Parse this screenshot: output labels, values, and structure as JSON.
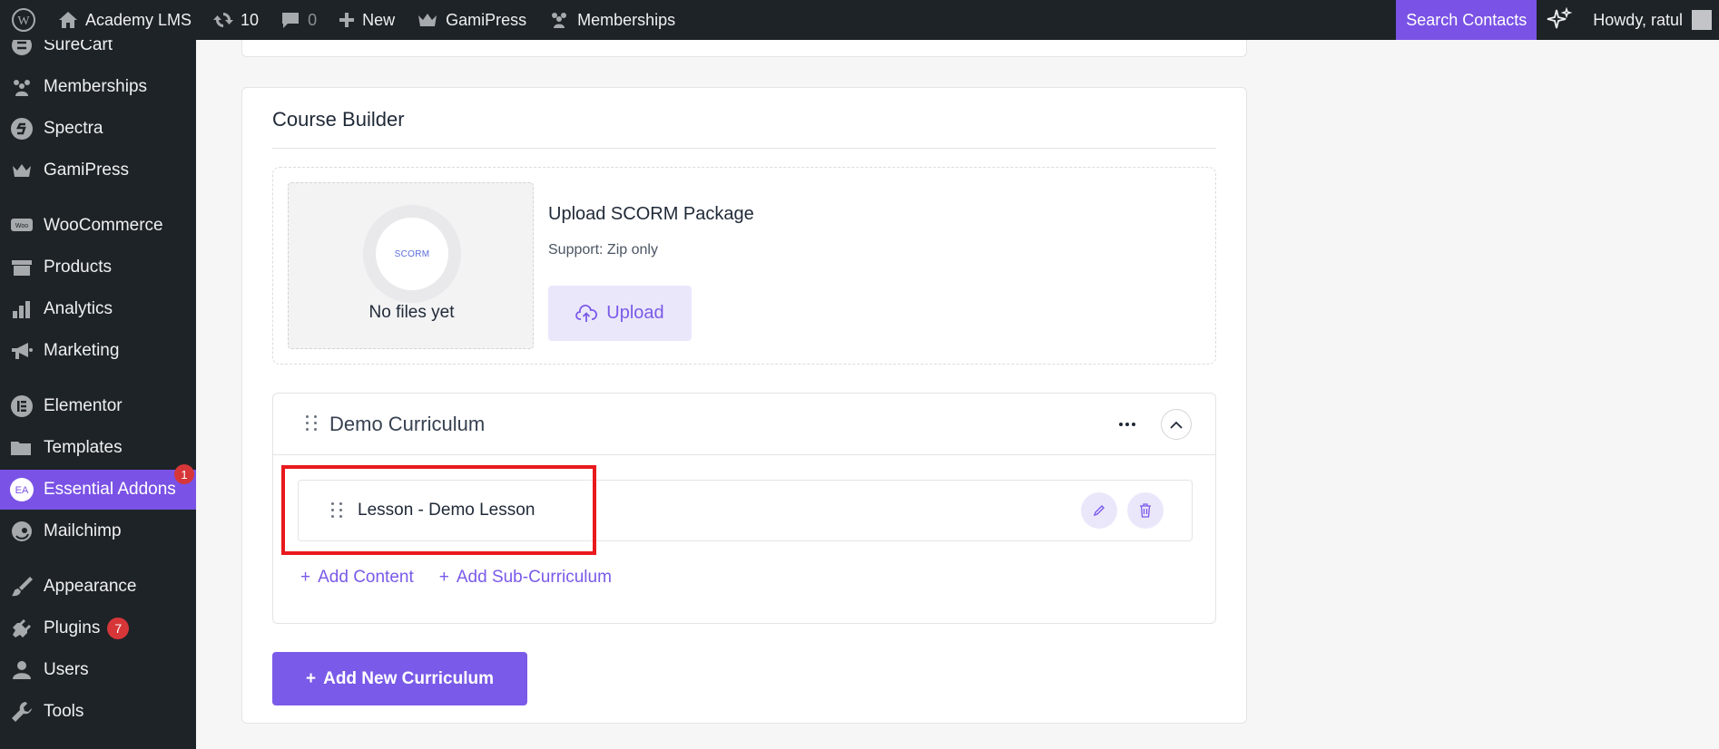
{
  "admin_bar": {
    "site_name": "Academy LMS",
    "updates_count": "10",
    "comments_count": "0",
    "new_label": "New",
    "gamipress_label": "GamiPress",
    "memberships_label": "Memberships",
    "search_contacts_label": "Search Contacts",
    "howdy_label": "Howdy, ratul"
  },
  "sidebar": {
    "items": [
      {
        "label": "SureCart",
        "icon": "surecart-icon"
      },
      {
        "label": "Memberships",
        "icon": "memberships-icon"
      },
      {
        "label": "Spectra",
        "icon": "spectra-icon"
      },
      {
        "label": "GamiPress",
        "icon": "crown-icon"
      },
      {
        "label": "WooCommerce",
        "icon": "woocommerce-icon"
      },
      {
        "label": "Products",
        "icon": "archive-icon"
      },
      {
        "label": "Analytics",
        "icon": "bar-chart-icon"
      },
      {
        "label": "Marketing",
        "icon": "megaphone-icon"
      },
      {
        "label": "Elementor",
        "icon": "elementor-icon"
      },
      {
        "label": "Templates",
        "icon": "folder-icon"
      },
      {
        "label": "Essential Addons",
        "icon": "essential-addons-icon",
        "badge": "1",
        "active": true
      },
      {
        "label": "Mailchimp",
        "icon": "mailchimp-icon"
      },
      {
        "label": "Appearance",
        "icon": "paintbrush-icon"
      },
      {
        "label": "Plugins",
        "icon": "plugin-icon",
        "badge": "7"
      },
      {
        "label": "Users",
        "icon": "user-icon"
      },
      {
        "label": "Tools",
        "icon": "wrench-icon"
      }
    ]
  },
  "course_builder": {
    "title": "Course Builder",
    "scorm": {
      "logo_text": "SCORM",
      "no_files": "No files yet",
      "title": "Upload SCORM Package",
      "support": "Support: Zip only",
      "upload_label": "Upload"
    },
    "curriculum": {
      "title": "Demo Curriculum",
      "lesson_title": "Lesson - Demo Lesson",
      "add_content": "Add Content",
      "add_sub_curriculum": "Add Sub-Curriculum"
    },
    "add_new_curriculum": "Add New Curriculum"
  },
  "colors": {
    "accent": "#7a5ae8",
    "admin_bg": "#1d2327",
    "highlight": "#e8191d",
    "badge": "#d63638"
  }
}
